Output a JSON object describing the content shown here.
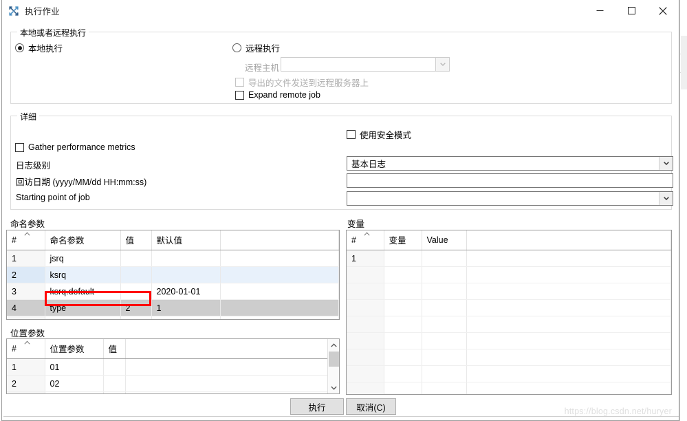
{
  "window": {
    "title": "执行作业",
    "icon": "run-job-icon",
    "minimize_label": "minimize",
    "maximize_label": "maximize",
    "close_label": "close"
  },
  "execution_group": {
    "title": "本地或者远程执行",
    "local_radio": "本地执行",
    "local_selected": true,
    "remote_radio": "远程执行",
    "remote_selected": false,
    "remote_host_label": "远程主机",
    "remote_host_value": "",
    "send_file_checkbox": "导出的文件发送到远程服务器上",
    "send_file_checked": false,
    "expand_remote_checkbox": "Expand remote job",
    "expand_remote_checked": false
  },
  "details_group": {
    "title": "详细",
    "gather_metrics_label": "Gather performance metrics",
    "gather_metrics_checked": false,
    "log_level_label": "日志级别",
    "log_level_value": "基本日志",
    "replay_date_label": "回访日期 (yyyy/MM/dd HH:mm:ss)",
    "replay_date_value": "",
    "starting_point_label": "Starting point of job",
    "starting_point_value": "",
    "safe_mode_checkbox": "使用安全模式",
    "safe_mode_checked": false
  },
  "named_params": {
    "title": "命名参数",
    "columns": [
      "#",
      "命名参数",
      "值",
      "默认值",
      ""
    ],
    "rows": [
      {
        "idx": "1",
        "name": "jsrq",
        "value": "",
        "default": "",
        "state": "normal"
      },
      {
        "idx": "2",
        "name": "ksrq",
        "value": "",
        "default": "",
        "state": "alt"
      },
      {
        "idx": "3",
        "name": "ksrq.default",
        "value": "",
        "default": "2020-01-01",
        "state": "normal"
      },
      {
        "idx": "4",
        "name": "type",
        "value": "2",
        "default": "1",
        "state": "sel"
      },
      {
        "idx": "",
        "name": "",
        "value": "",
        "default": "",
        "state": "normal"
      }
    ],
    "highlight_color": "#ff0000"
  },
  "variables": {
    "title": "变量",
    "columns": [
      "#",
      "变量",
      "Value",
      ""
    ],
    "rows": [
      {
        "idx": "1",
        "name": "",
        "value": "",
        "state": "normal"
      },
      {
        "idx": "",
        "name": "",
        "value": "",
        "state": "normal"
      },
      {
        "idx": "",
        "name": "",
        "value": "",
        "state": "normal"
      },
      {
        "idx": "",
        "name": "",
        "value": "",
        "state": "normal"
      },
      {
        "idx": "",
        "name": "",
        "value": "",
        "state": "normal"
      },
      {
        "idx": "",
        "name": "",
        "value": "",
        "state": "normal"
      },
      {
        "idx": "",
        "name": "",
        "value": "",
        "state": "normal"
      },
      {
        "idx": "",
        "name": "",
        "value": "",
        "state": "normal"
      },
      {
        "idx": "",
        "name": "",
        "value": "",
        "state": "normal"
      },
      {
        "idx": "",
        "name": "",
        "value": "",
        "state": "normal"
      }
    ]
  },
  "positional_params": {
    "title": "位置参数",
    "columns": [
      "#",
      "位置参数",
      "值",
      ""
    ],
    "rows": [
      {
        "idx": "1",
        "name": "01",
        "value": "",
        "state": "normal"
      },
      {
        "idx": "2",
        "name": "02",
        "value": "",
        "state": "normal"
      },
      {
        "idx": "",
        "name": "",
        "value": "",
        "state": "normal"
      }
    ]
  },
  "footer": {
    "execute_label": "执行",
    "cancel_label": "取消(C)"
  },
  "watermark": "https://blog.csdn.net/huryer"
}
